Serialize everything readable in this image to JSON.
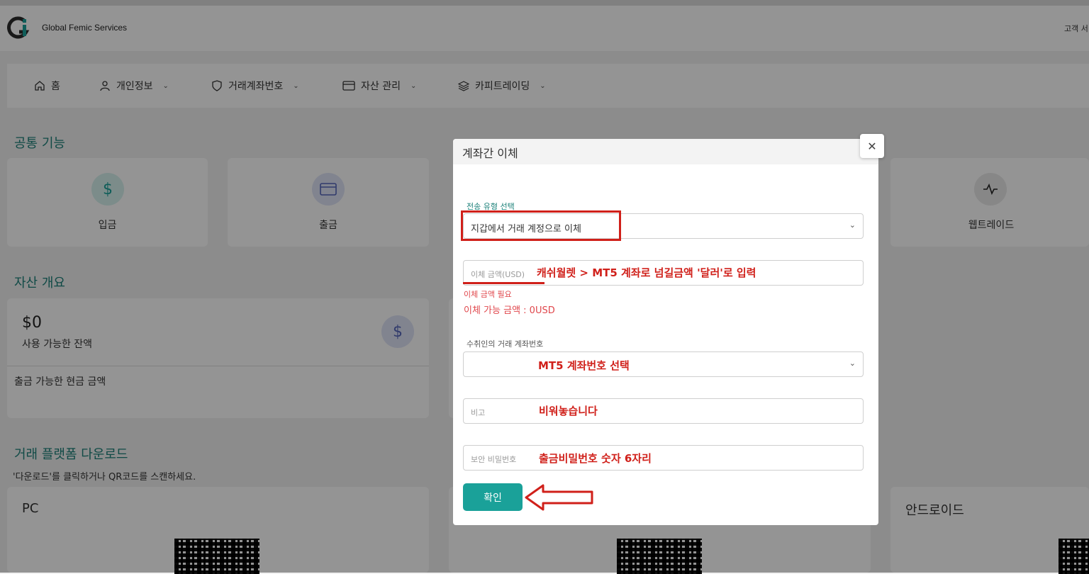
{
  "header": {
    "brand": "Global Femic Services",
    "right_text": "고객 서"
  },
  "nav": {
    "items": [
      {
        "label": "홈",
        "icon": "home-icon"
      },
      {
        "label": "개인정보",
        "icon": "user-icon"
      },
      {
        "label": "거래계좌번호",
        "icon": "shield-icon"
      },
      {
        "label": "자산 관리",
        "icon": "card-icon"
      },
      {
        "label": "카피트레이딩",
        "icon": "layers-icon"
      }
    ]
  },
  "common": {
    "title": "공통 기능",
    "cards": [
      "입금",
      "출금",
      "웹트레이드"
    ]
  },
  "assets": {
    "title": "자산 개요",
    "balance": "$0",
    "balance_label": "사용 가능한 잔액",
    "cash_label": "출금 가능한 현금 금액"
  },
  "download": {
    "title": "거래 플랫폼 다운로드",
    "subtitle": "'다운로드'를 클릭하거나 QR코드를 스캔하세요.",
    "platforms": [
      "PC",
      "안드로이드"
    ]
  },
  "modal": {
    "title": "계좌간 이체",
    "transfer_type_label": "전송 유형 선택",
    "transfer_type_value": "지갑에서 거래 계정으로 이체",
    "amount_placeholder": "이체 금액(USD)",
    "amount_error": "이체 금액 필요",
    "available": "이체 가능 금액 : 0USD",
    "recipient_label": "수취인의 거래 계좌번호",
    "memo_placeholder": "비고",
    "password_placeholder": "보안 비밀번호",
    "confirm_label": "확인"
  },
  "annotations": {
    "amount_note": "캐쉬월렛 > MT5 계좌로 넘길금액 '달러'로 입력",
    "account_note": "MT5 계좌번호 선택",
    "memo_note": "비워놓습니다",
    "password_note": "출금비밀번호 숫자 6자리"
  },
  "colors": {
    "accent": "#1aa199",
    "annotation_red": "#d0201a"
  }
}
